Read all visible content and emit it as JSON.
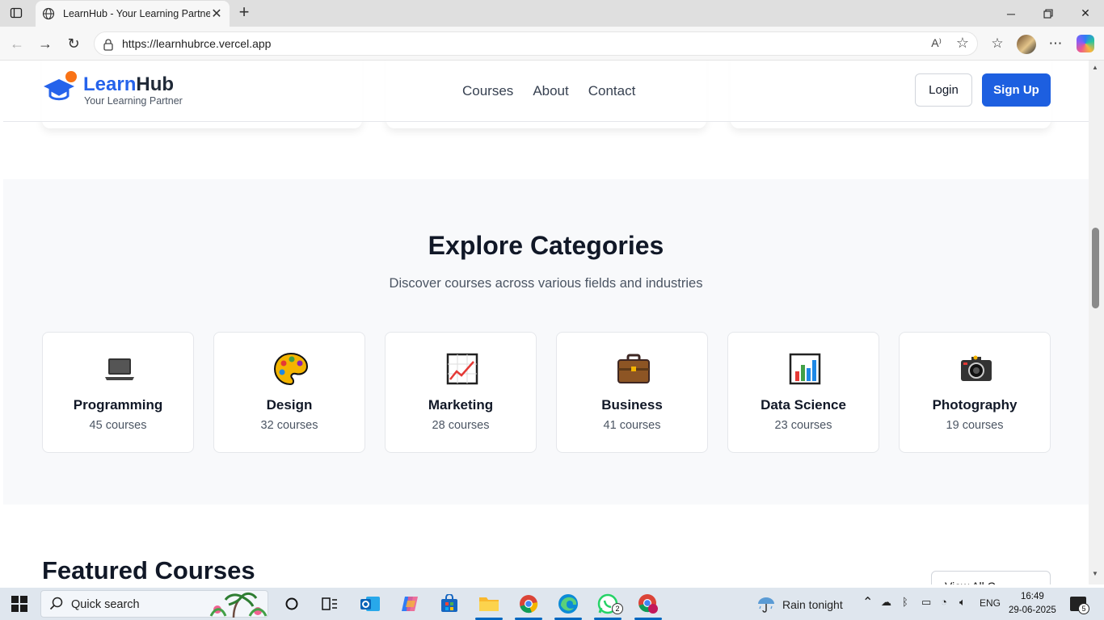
{
  "browser": {
    "tab_title": "LearnHub - Your Learning Partner",
    "address": "https://learnhubrce.vercel.app",
    "read_aloud_label": "A⁾",
    "icons": [
      "tab-actions-icon",
      "globe-icon",
      "close-tab-icon",
      "new-tab-icon",
      "back-icon",
      "forward-icon",
      "refresh-icon",
      "lock-icon",
      "read-aloud-icon",
      "favorite-star-icon",
      "favorites-icon",
      "profile-avatar",
      "more-icon",
      "copilot-icon"
    ]
  },
  "site": {
    "logo_learn": "Learn",
    "logo_hub": "Hub",
    "tagline": "Your Learning Partner",
    "nav": [
      "Courses",
      "About",
      "Contact"
    ],
    "login": "Login",
    "signup": "Sign Up",
    "accent": "#1d5fe0",
    "logo_dot": "#f97316"
  },
  "categories": {
    "title": "Explore Categories",
    "subtitle": "Discover courses across various fields and industries",
    "items": [
      {
        "name": "Programming",
        "count": "45 courses",
        "icon": "laptop-icon"
      },
      {
        "name": "Design",
        "count": "32 courses",
        "icon": "palette-icon"
      },
      {
        "name": "Marketing",
        "count": "28 courses",
        "icon": "chart-increasing-icon"
      },
      {
        "name": "Business",
        "count": "41 courses",
        "icon": "briefcase-icon"
      },
      {
        "name": "Data Science",
        "count": "23 courses",
        "icon": "bar-chart-icon"
      },
      {
        "name": "Photography",
        "count": "19 courses",
        "icon": "camera-icon"
      }
    ]
  },
  "featured": {
    "title": "Featured Courses",
    "view_all": "View All C"
  },
  "taskbar": {
    "search_placeholder": "Quick search",
    "weather": "Rain tonight",
    "language": "ENG",
    "time": "16:49",
    "date": "29-06-2025",
    "whatsapp_badge": "2",
    "notifications": "5"
  }
}
